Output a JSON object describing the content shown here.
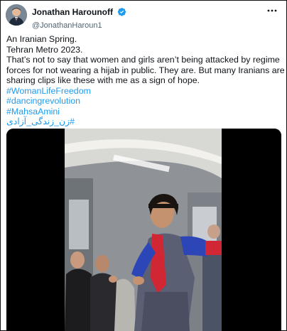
{
  "tweet": {
    "author": {
      "display_name": "Jonathan Harounoff",
      "handle": "@JonathanHaroun1",
      "verified": true,
      "avatar_icon": "profile-photo"
    },
    "more_icon": "more-horizontal-icon",
    "lines": [
      "An Iranian Spring.",
      "Tehran Metro 2023.",
      "That’s not to say that women and girls aren’t being attacked by regime forces for not wearing a hijab in public. They are. But many Iranians are sharing clips like these with me as a sign of hope."
    ],
    "hashtags": [
      "#WomanLifeFreedom",
      "#dancingrevolution",
      "#MahsaAmini",
      "#زن_زندگی_آزادی"
    ],
    "media": {
      "type": "video",
      "description_icon": "video-thumbnail"
    }
  },
  "colors": {
    "link": "#1d9bf0",
    "verified": "#1d9bf0",
    "text": "#0f1419",
    "secondary": "#536471"
  }
}
